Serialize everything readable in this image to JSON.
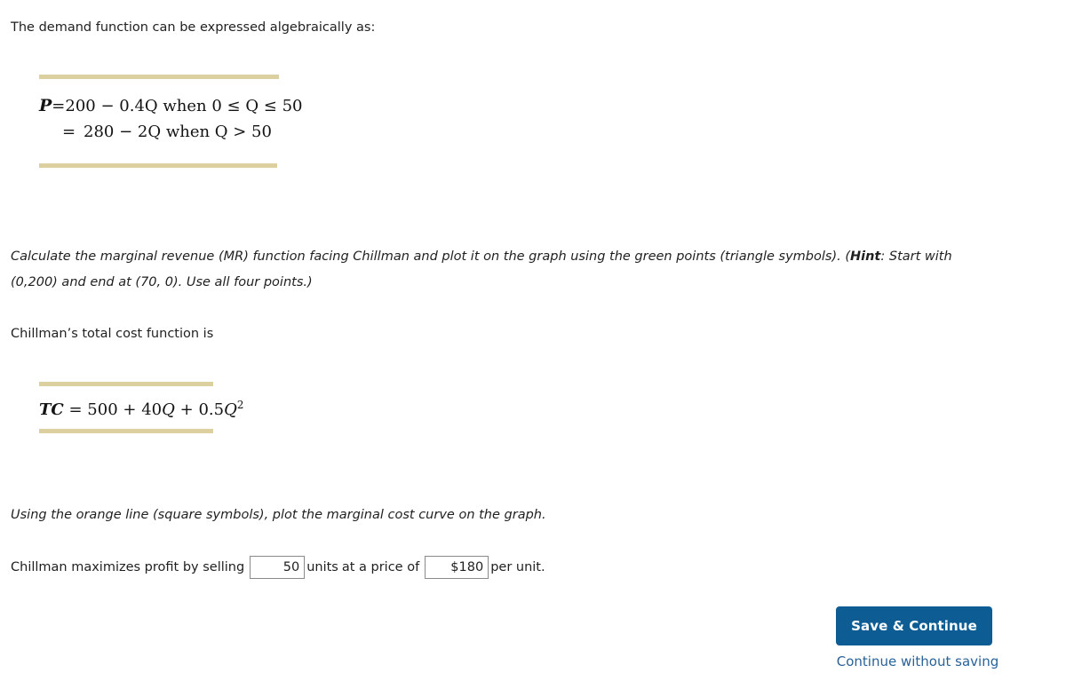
{
  "intro": {
    "text": "The demand function can be expressed algebraically as:"
  },
  "demand_block": {
    "lhs": "P",
    "line1": {
      "sign": "=",
      "rhs_plain": "200 − 0.4Q when 0 ≤ Q ≤ 50",
      "intercept": "200",
      "minus": "−",
      "slope_term": "0.4Q",
      "condition": "when 0 ≤ Q ≤ 50"
    },
    "line2": {
      "sign": "=",
      "rhs_plain": "280 − 2Q when Q > 50",
      "intercept": "280",
      "minus": "−",
      "slope_term": "2Q",
      "condition": "when Q > 50"
    }
  },
  "mr_instruction": {
    "line1_before_hint": "Calculate the marginal revenue (MR) function facing Chillman and plot it on the graph using the green points (triangle symbols). (",
    "hint_label": "Hint",
    "line1_after_hint": ": Start with",
    "line2": "(0,200) and end at (70, 0). Use all four points.)"
  },
  "tc_lead": {
    "text": "Chillman’s total cost function is"
  },
  "tc_block": {
    "lhs": "TC",
    "sign": "=",
    "fixed_cost": "500",
    "plus1": "+",
    "linear_term": "40Q",
    "plus2": "+",
    "quadratic_coefficient": "0.5",
    "quadratic_var": "Q",
    "quadratic_exponent": "2",
    "full_text": "TC = 500 + 40Q + 0.5Q²"
  },
  "mc_instruction": {
    "text": "Using the orange line (square symbols), plot the marginal cost curve on the graph."
  },
  "answer_row": {
    "lead_text": "Chillman maximizes profit by selling",
    "units_value": "50",
    "units_placeholder": "",
    "units_label": "units",
    "middle_text": "at a price of",
    "price_value": "$180",
    "price_placeholder": "",
    "trailing_text": "per unit."
  },
  "footer": {
    "save_label": "Save & Continue",
    "continue_label": "Continue without saving"
  },
  "colors": {
    "rule_bar": "#ddd0a0",
    "button_blue": "#0d5d94",
    "link_blue": "#2a6298",
    "text": "#1f1f1f",
    "input_border": "#8a8a8a"
  }
}
